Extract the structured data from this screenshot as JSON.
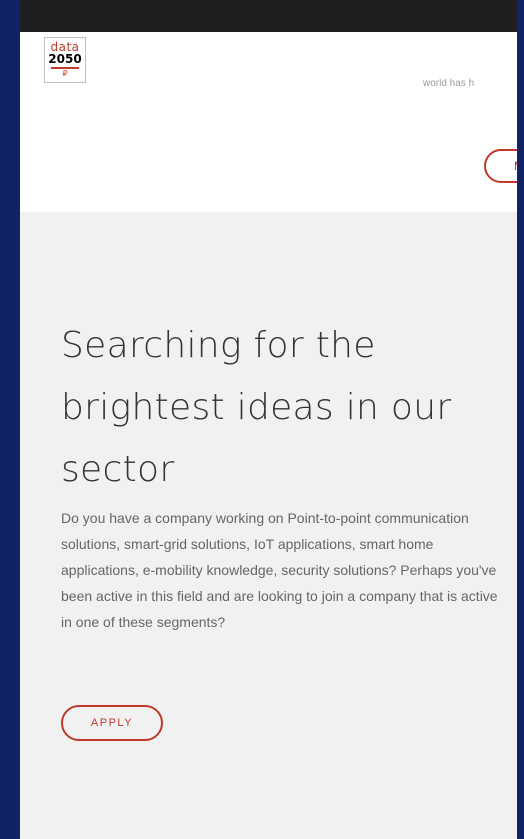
{
  "header": {
    "logo": {
      "line1": "data",
      "line2": "2050",
      "line3": "₽"
    },
    "partial_text": "world has h",
    "partial_button_label": "M"
  },
  "section": {
    "heading": "Searching for the brightest ideas in our sector",
    "paragraph": "Do you have a company working on Point-to-point communication solutions, smart-grid solutions, IoT applications, smart home applications, e-mobility knowledge, security solutions? Perhaps you've been active in this field and are looking to join a company that is active in one of these segments?",
    "apply_label": "APPLY"
  },
  "colors": {
    "accent": "#c0392b",
    "outer_background": "#122266",
    "top_bar": "#1f1f21",
    "section_background": "#f1f1f1"
  }
}
